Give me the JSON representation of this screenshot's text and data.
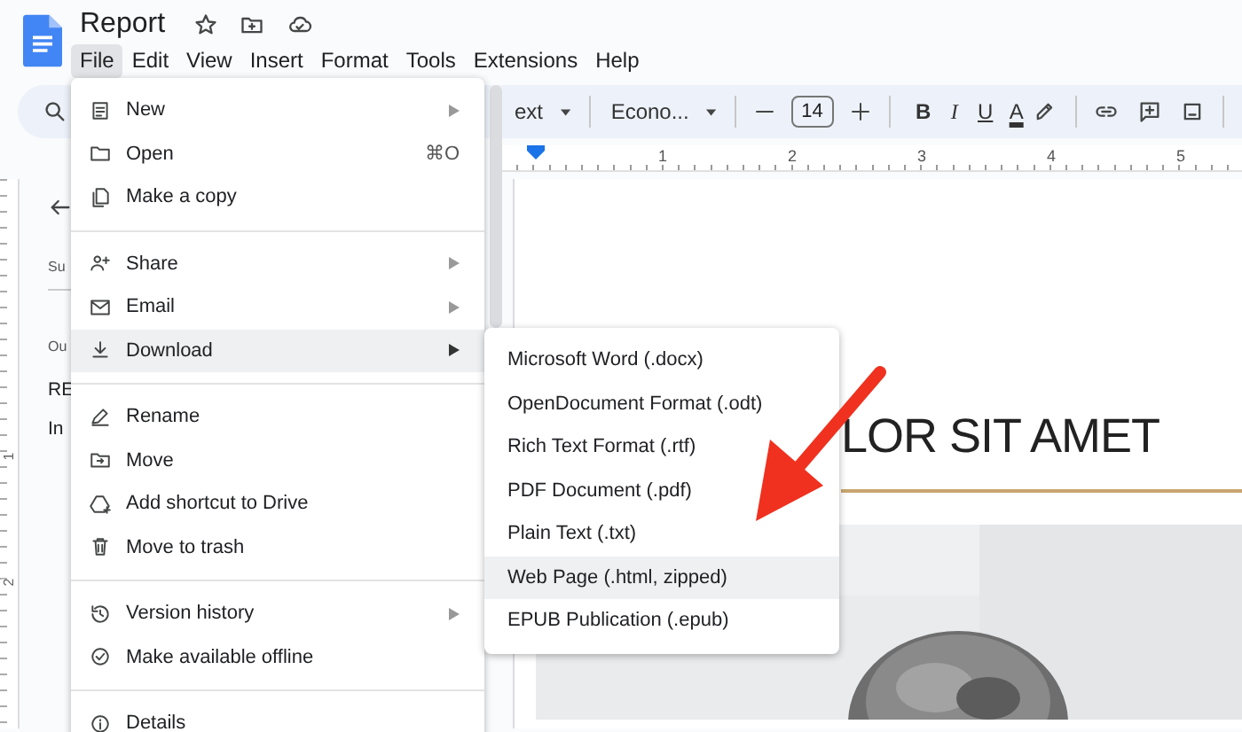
{
  "document": {
    "title": "Report"
  },
  "menu_bar": [
    {
      "label": "File",
      "selected": true
    },
    {
      "label": "Edit",
      "selected": false
    },
    {
      "label": "View",
      "selected": false
    },
    {
      "label": "Insert",
      "selected": false
    },
    {
      "label": "Format",
      "selected": false
    },
    {
      "label": "Tools",
      "selected": false
    },
    {
      "label": "Extensions",
      "selected": false
    },
    {
      "label": "Help",
      "selected": false
    }
  ],
  "toolbar": {
    "style": "ext",
    "font": "Econo...",
    "font_size": "14",
    "format_buttons": [
      "B",
      "I",
      "U",
      "A"
    ]
  },
  "ruler": [
    "1",
    "2",
    "3",
    "4",
    "5"
  ],
  "vertical_ruler": [
    "1",
    "2"
  ],
  "outline": {
    "subtitle": "Su",
    "heading": "Ou",
    "items": [
      "RE",
      "In"
    ]
  },
  "page": {
    "heading": "LOR SIT AMET"
  },
  "file_menu": [
    [
      {
        "label": "New",
        "has_submenu": true,
        "highlighted": false
      },
      {
        "label": "Open",
        "shortcut": "⌘O",
        "has_submenu": false,
        "highlighted": false
      },
      {
        "label": "Make a copy",
        "has_submenu": false,
        "highlighted": false
      }
    ],
    [
      {
        "label": "Share",
        "has_submenu": true,
        "highlighted": false
      },
      {
        "label": "Email",
        "has_submenu": true,
        "highlighted": false
      },
      {
        "label": "Download",
        "has_submenu": true,
        "highlighted": true
      }
    ],
    [
      {
        "label": "Rename",
        "has_submenu": false,
        "highlighted": false
      },
      {
        "label": "Move",
        "has_submenu": false,
        "highlighted": false
      },
      {
        "label": "Add shortcut to Drive",
        "has_submenu": false,
        "highlighted": false
      },
      {
        "label": "Move to trash",
        "has_submenu": false,
        "highlighted": false
      }
    ],
    [
      {
        "label": "Version history",
        "has_submenu": true,
        "highlighted": false
      },
      {
        "label": "Make available offline",
        "has_submenu": false,
        "highlighted": false
      }
    ],
    [
      {
        "label": "Details",
        "has_submenu": false,
        "highlighted": false
      }
    ]
  ],
  "download_submenu": [
    {
      "label": "Microsoft Word (.docx)",
      "highlighted": false
    },
    {
      "label": "OpenDocument Format (.odt)",
      "highlighted": false
    },
    {
      "label": "Rich Text Format (.rtf)",
      "highlighted": false
    },
    {
      "label": "PDF Document (.pdf)",
      "highlighted": false
    },
    {
      "label": "Plain Text (.txt)",
      "highlighted": false
    },
    {
      "label": "Web Page (.html, zipped)",
      "highlighted": true
    },
    {
      "label": "EPUB Publication (.epub)",
      "highlighted": false
    }
  ]
}
